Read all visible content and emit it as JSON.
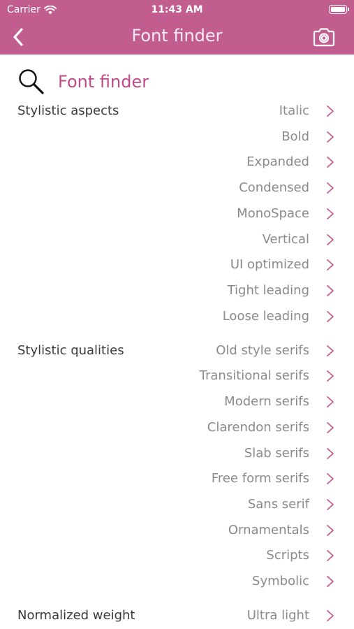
{
  "status_bar": {
    "carrier": "Carrier",
    "time": "11:43 AM"
  },
  "nav": {
    "title": "Font finder",
    "back_icon": "chevron-left-icon",
    "camera_icon": "camera-icon"
  },
  "search": {
    "label": "Font finder",
    "icon": "magnifier-icon"
  },
  "colors": {
    "accent": "#c25d8f",
    "accent_text": "#c04a86",
    "secondary_text": "#8a8a8a"
  },
  "sections": [
    {
      "label": "Stylistic aspects",
      "options": [
        "Italic",
        "Bold",
        "Expanded",
        "Condensed",
        "MonoSpace",
        "Vertical",
        "UI optimized",
        "Tight leading",
        "Loose leading"
      ]
    },
    {
      "label": "Stylistic qualities",
      "options": [
        "Old style serifs",
        "Transitional serifs",
        "Modern serifs",
        "Clarendon serifs",
        "Slab serifs",
        "Free form serifs",
        "Sans serif",
        "Ornamentals",
        "Scripts",
        "Symbolic"
      ]
    },
    {
      "label": "Normalized weight",
      "options": [
        "Ultra light"
      ]
    }
  ]
}
